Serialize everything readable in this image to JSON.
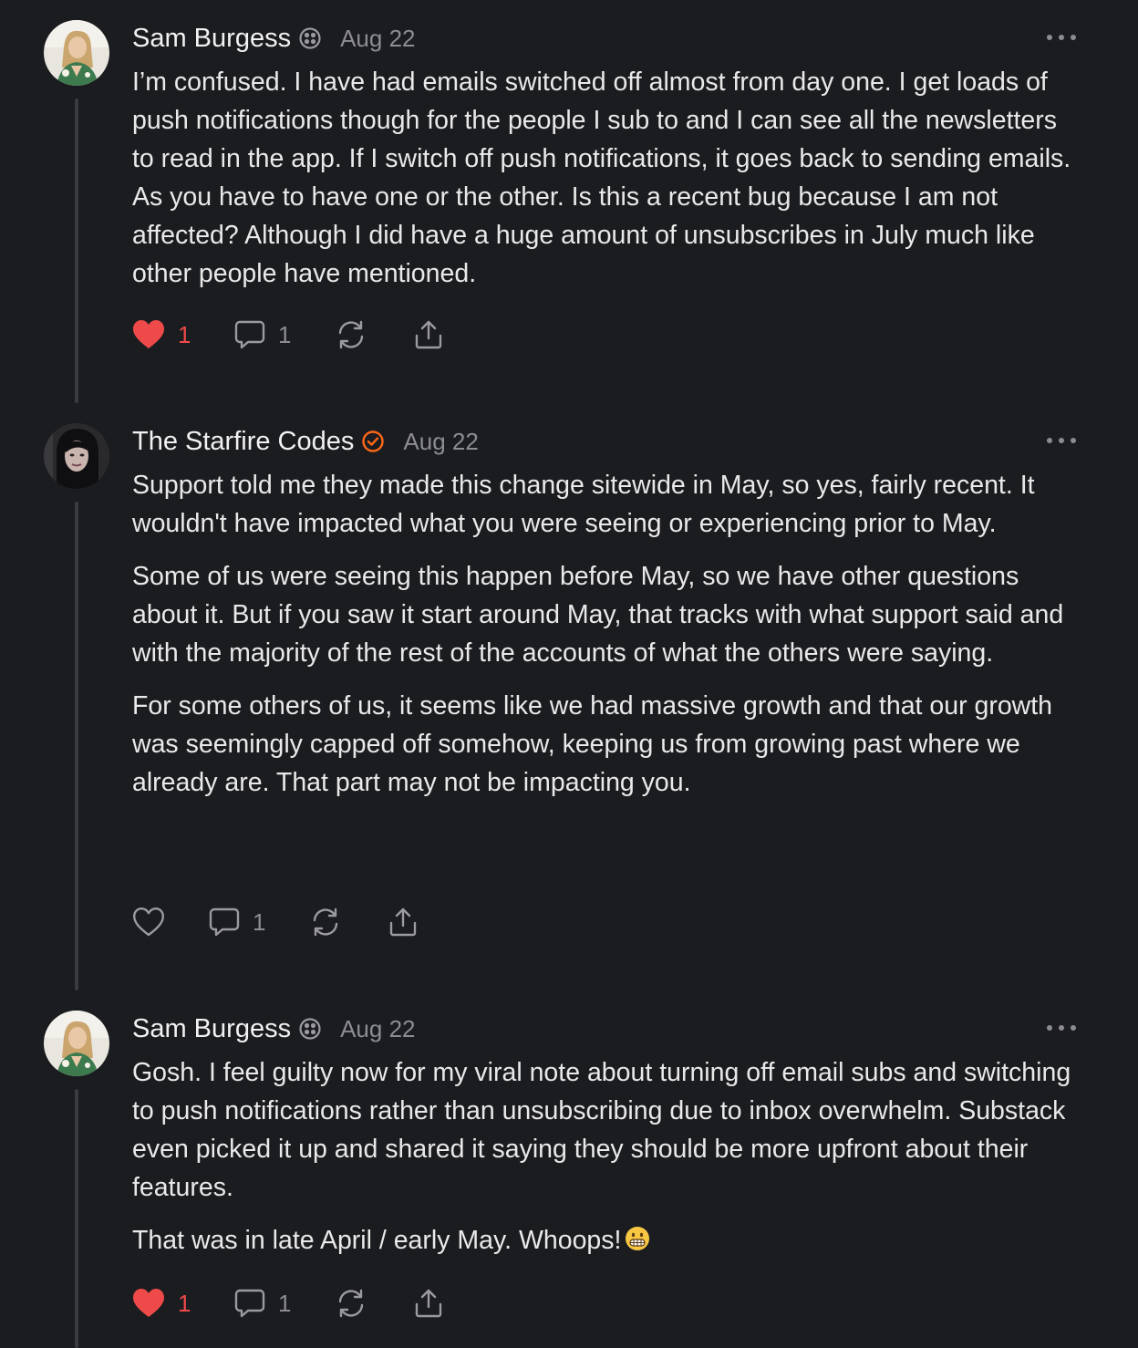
{
  "colors": {
    "background": "#1b1c1f",
    "text": "#e9e9ea",
    "muted": "#8c8c91",
    "like_red": "#ef4a4a",
    "verified_orange": "#ff6719",
    "thread_line": "#3a3b3f"
  },
  "comments": [
    {
      "author": "Sam Burgess",
      "badge_icon": "founding-member-badge-icon",
      "date": "Aug 22",
      "paragraphs": [
        "I’m confused. I have had emails switched off almost from day one. I get loads of push notifications though for the people I sub to and I can see all the newsletters to read in the app. If I switch off push notifications, it goes back to sending emails. As you have to have one or the other. Is this a recent bug because I am not affected? Although I did have a huge amount of unsubscribes in July much like other people have mentioned."
      ],
      "likes": "1",
      "liked": true,
      "replies": "1"
    },
    {
      "author": "The Starfire Codes",
      "badge_icon": "verified-check-icon",
      "date": "Aug 22",
      "paragraphs": [
        "Support told me they made this change sitewide in May, so yes, fairly recent. It wouldn't have impacted what you were seeing or experiencing prior to May.",
        "Some of us were seeing this happen before May, so we have other questions about it. But if you saw it start around May, that tracks with what support said and with the majority of the rest of the accounts of what the others were saying.",
        "For some others of us, it seems like we had massive growth and that our growth was seemingly capped off somehow, keeping us from growing past where we already are. That part may not be impacting you."
      ],
      "likes": "",
      "liked": false,
      "replies": "1"
    },
    {
      "author": "Sam Burgess",
      "badge_icon": "founding-member-badge-icon",
      "date": "Aug 22",
      "paragraphs": [
        "Gosh. I feel guilty now for my viral note about turning off email subs and switching to push notifications rather than unsubscribing due to inbox overwhelm. Substack even picked it up and shared it saying they should be more upfront about their features.",
        "That was in late April / early May. Whoops!"
      ],
      "trailing_emoji": "grimacing-face-emoji",
      "likes": "1",
      "liked": true,
      "replies": "1"
    }
  ]
}
